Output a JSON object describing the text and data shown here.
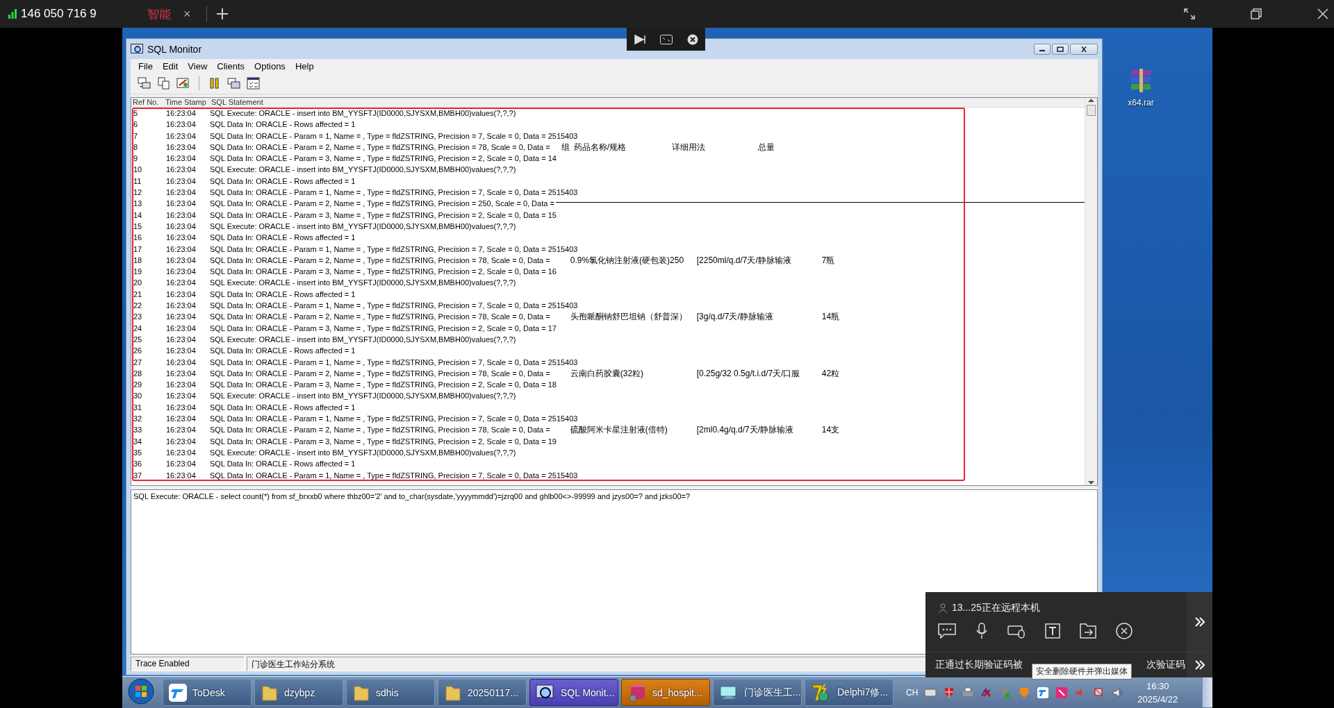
{
  "remote_bar": {
    "session_id": "146 050 716 9",
    "tabs": [
      {
        "label": "智能",
        "close": "×",
        "selected": true
      }
    ]
  },
  "window": {
    "title": "SQL Monitor",
    "menu": [
      "File",
      "Edit",
      "View",
      "Clients",
      "Options",
      "Help"
    ],
    "columns": [
      "Ref No.",
      "Time Stamp",
      "SQL Statement"
    ],
    "rows": [
      {
        "ref": "5",
        "time": "16:23:04",
        "statement": "SQL Execute: ORACLE - insert into BM_YYSFTJ(ID0000,SJYSXM,BMBH00)values(?,?,?)",
        "kind": "plain"
      },
      {
        "ref": "6",
        "time": "16:23:04",
        "statement": "SQL Data In: ORACLE - Rows affected = 1",
        "kind": "plain"
      },
      {
        "ref": "7",
        "time": "16:23:04",
        "statement": "SQL Data In: ORACLE - Param = 1, Name = , Type = fldZSTRING, Precision = 7, Scale = 0, Data = 2515403",
        "kind": "plain"
      },
      {
        "ref": "8",
        "time": "16:23:04",
        "statement": "SQL Data In: ORACLE - Param = 2, Name = , Type = fldZSTRING, Precision = 78, Scale = 0, Data =",
        "kind": "header",
        "data": [
          "组",
          "药品名称/规格",
          "详细用法",
          "总量"
        ]
      },
      {
        "ref": "9",
        "time": "16:23:04",
        "statement": "SQL Data In: ORACLE - Param = 3, Name = , Type = fldZSTRING, Precision = 2, Scale = 0, Data = 14",
        "kind": "plain"
      },
      {
        "ref": "10",
        "time": "16:23:04",
        "statement": "SQL Execute: ORACLE - insert into BM_YYSFTJ(ID0000,SJYSXM,BMBH00)values(?,?,?)",
        "kind": "plain"
      },
      {
        "ref": "11",
        "time": "16:23:04",
        "statement": "SQL Data In: ORACLE - Rows affected = 1",
        "kind": "plain"
      },
      {
        "ref": "12",
        "time": "16:23:04",
        "statement": "SQL Data In: ORACLE - Param = 1, Name = , Type = fldZSTRING, Precision = 7, Scale = 0, Data = 2515403",
        "kind": "plain"
      },
      {
        "ref": "13",
        "time": "16:23:04",
        "statement": "SQL Data In: ORACLE - Param = 2, Name = , Type = fldZSTRING, Precision = 250, Scale = 0, Data =",
        "kind": "line"
      },
      {
        "ref": "14",
        "time": "16:23:04",
        "statement": "SQL Data In: ORACLE - Param = 3, Name = , Type = fldZSTRING, Precision = 2, Scale = 0, Data = 15",
        "kind": "plain"
      },
      {
        "ref": "15",
        "time": "16:23:04",
        "statement": "SQL Execute: ORACLE - insert into BM_YYSFTJ(ID0000,SJYSXM,BMBH00)values(?,?,?)",
        "kind": "plain"
      },
      {
        "ref": "16",
        "time": "16:23:04",
        "statement": "SQL Data In: ORACLE - Rows affected = 1",
        "kind": "plain"
      },
      {
        "ref": "17",
        "time": "16:23:04",
        "statement": "SQL Data In: ORACLE - Param = 1, Name = , Type = fldZSTRING, Precision = 7, Scale = 0, Data = 2515403",
        "kind": "plain"
      },
      {
        "ref": "18",
        "time": "16:23:04",
        "statement": "SQL Data In: ORACLE - Param = 2, Name = , Type = fldZSTRING, Precision = 78, Scale = 0, Data =",
        "kind": "item",
        "data": [
          "0.9%氯化钠注射液(硬包装)250",
          "[2250ml/q.d/7天/静脉输液",
          "7瓶"
        ]
      },
      {
        "ref": "19",
        "time": "16:23:04",
        "statement": "SQL Data In: ORACLE - Param = 3, Name = , Type = fldZSTRING, Precision = 2, Scale = 0, Data = 16",
        "kind": "plain"
      },
      {
        "ref": "20",
        "time": "16:23:04",
        "statement": "SQL Execute: ORACLE - insert into BM_YYSFTJ(ID0000,SJYSXM,BMBH00)values(?,?,?)",
        "kind": "plain"
      },
      {
        "ref": "21",
        "time": "16:23:04",
        "statement": "SQL Data In: ORACLE - Rows affected = 1",
        "kind": "plain"
      },
      {
        "ref": "22",
        "time": "16:23:04",
        "statement": "SQL Data In: ORACLE - Param = 1, Name = , Type = fldZSTRING, Precision = 7, Scale = 0, Data = 2515403",
        "kind": "plain"
      },
      {
        "ref": "23",
        "time": "16:23:04",
        "statement": "SQL Data In: ORACLE - Param = 2, Name = , Type = fldZSTRING, Precision = 78, Scale = 0, Data =",
        "kind": "item",
        "data": [
          "头孢哌酮钠舒巴坦钠（舒普深）",
          "[3g/q.d/7天/静脉输液",
          "14瓶"
        ]
      },
      {
        "ref": "24",
        "time": "16:23:04",
        "statement": "SQL Data In: ORACLE - Param = 3, Name = , Type = fldZSTRING, Precision = 2, Scale = 0, Data = 17",
        "kind": "plain"
      },
      {
        "ref": "25",
        "time": "16:23:04",
        "statement": "SQL Execute: ORACLE - insert into BM_YYSFTJ(ID0000,SJYSXM,BMBH00)values(?,?,?)",
        "kind": "plain"
      },
      {
        "ref": "26",
        "time": "16:23:04",
        "statement": "SQL Data In: ORACLE - Rows affected = 1",
        "kind": "plain"
      },
      {
        "ref": "27",
        "time": "16:23:04",
        "statement": "SQL Data In: ORACLE - Param = 1, Name = , Type = fldZSTRING, Precision = 7, Scale = 0, Data = 2515403",
        "kind": "plain"
      },
      {
        "ref": "28",
        "time": "16:23:04",
        "statement": "SQL Data In: ORACLE - Param = 2, Name = , Type = fldZSTRING, Precision = 78, Scale = 0, Data =",
        "kind": "item",
        "data": [
          "云南白药胶囊(32粒)",
          "[0.25g/32 0.5g/t.i.d/7天/口服",
          "42粒"
        ]
      },
      {
        "ref": "29",
        "time": "16:23:04",
        "statement": "SQL Data In: ORACLE - Param = 3, Name = , Type = fldZSTRING, Precision = 2, Scale = 0, Data = 18",
        "kind": "plain"
      },
      {
        "ref": "30",
        "time": "16:23:04",
        "statement": "SQL Execute: ORACLE - insert into BM_YYSFTJ(ID0000,SJYSXM,BMBH00)values(?,?,?)",
        "kind": "plain"
      },
      {
        "ref": "31",
        "time": "16:23:04",
        "statement": "SQL Data In: ORACLE - Rows affected = 1",
        "kind": "plain"
      },
      {
        "ref": "32",
        "time": "16:23:04",
        "statement": "SQL Data In: ORACLE - Param = 1, Name = , Type = fldZSTRING, Precision = 7, Scale = 0, Data = 2515403",
        "kind": "plain"
      },
      {
        "ref": "33",
        "time": "16:23:04",
        "statement": "SQL Data In: ORACLE - Param = 2, Name = , Type = fldZSTRING, Precision = 78, Scale = 0, Data =",
        "kind": "item",
        "data": [
          "硫酸阿米卡星注射液(倍特)",
          "[2ml0.4g/q.d/7天/静脉输液",
          "14支"
        ]
      },
      {
        "ref": "34",
        "time": "16:23:04",
        "statement": "SQL Data In: ORACLE - Param = 3, Name = , Type = fldZSTRING, Precision = 2, Scale = 0, Data = 19",
        "kind": "plain"
      },
      {
        "ref": "35",
        "time": "16:23:04",
        "statement": "SQL Execute: ORACLE - insert into BM_YYSFTJ(ID0000,SJYSXM,BMBH00)values(?,?,?)",
        "kind": "plain"
      },
      {
        "ref": "36",
        "time": "16:23:04",
        "statement": "SQL Data In: ORACLE - Rows affected = 1",
        "kind": "plain"
      },
      {
        "ref": "37",
        "time": "16:23:04",
        "statement": "SQL Data In: ORACLE - Param = 1, Name = , Type = fldZSTRING, Precision = 7, Scale = 0, Data = 2515403",
        "kind": "plain"
      }
    ],
    "detail": "SQL Execute: ORACLE - select count(*) from sf_brxxb0 where thbz00='2' and to_char(sysdate,'yyyymmdd')=jzrq00 and ghlb00<>-99999 and  jzys00=? and jzks00=?",
    "status": [
      "Trace Enabled",
      "门诊医生工作站分系统"
    ]
  },
  "desktop_icons": [
    {
      "label": "x64.rar"
    }
  ],
  "taskbar": {
    "items": [
      {
        "label": "ToDesk",
        "kind": "todesk",
        "selected": false,
        "flashing": false
      },
      {
        "label": "dzybpz",
        "kind": "folder",
        "selected": false,
        "flashing": false
      },
      {
        "label": "sdhis",
        "kind": "folder",
        "selected": false,
        "flashing": false
      },
      {
        "label": "20250117...",
        "kind": "folder",
        "selected": false,
        "flashing": false
      },
      {
        "label": "SQL Monit...",
        "kind": "sqlmonitor",
        "selected": true,
        "flashing": false
      },
      {
        "label": "sd_hospit...",
        "kind": "database",
        "selected": false,
        "flashing": true
      },
      {
        "label": "门诊医生工...",
        "kind": "app",
        "selected": false,
        "flashing": false
      },
      {
        "label": "Delphi7修...",
        "kind": "delphi",
        "selected": false,
        "flashing": false
      }
    ],
    "language": "CH",
    "time": "16:30",
    "date": "2025/4/22"
  },
  "remote_panel": {
    "session_text": "13...25正在远程本机",
    "notice_parts": [
      "正通过长期验证码被",
      "次验证码"
    ]
  },
  "tooltip": "安全删除硬件并弹出媒体"
}
